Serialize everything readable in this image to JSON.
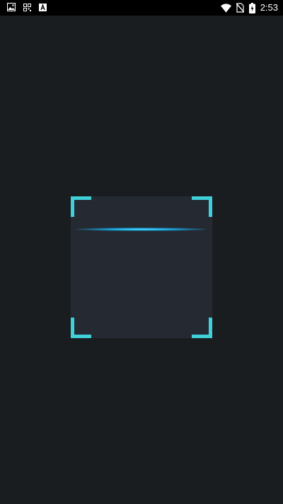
{
  "status_bar": {
    "time": "2:53",
    "left_icons": [
      "image-icon",
      "qr-code-icon",
      "font-icon"
    ],
    "right_icons": [
      "wifi-icon",
      "no-sim-icon",
      "battery-charging-icon"
    ]
  },
  "scanner": {
    "corner_color": "#3fd0d8",
    "scan_line_color": "#1aa8e0",
    "frame_background": "#252a32",
    "page_background": "#1a1d20"
  }
}
